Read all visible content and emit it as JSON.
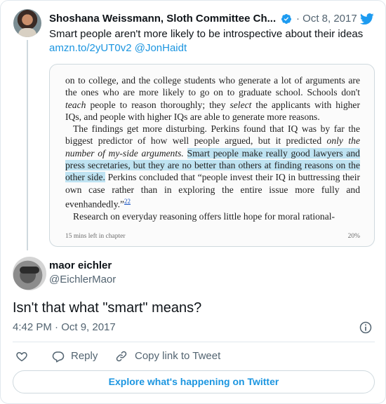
{
  "parent_tweet": {
    "author_name": "Shoshana Weissmann, Sloth Committee Ch...",
    "date": "· Oct 8, 2017",
    "text": "Smart people aren't more likely to be introspective about their ideas",
    "link": "amzn.to/2yUT0v2",
    "mention": "@JonHaidt",
    "book_page": {
      "para1": "on to college, and the college students who generate a lot of arguments are the ones who are more likely to go on to graduate school. Schools don't",
      "para1_em1": "teach",
      "para1_mid": "people to reason thoroughly; they",
      "para1_em2": "select",
      "para1_end": "the applicants with higher IQs, and people with higher IQs are able to generate more reasons.",
      "para2_start": "The findings get more disturbing. Perkins found that IQ was by far the biggest predictor of how well people argued, but it predicted",
      "para2_em": "only the number of my-side arguments.",
      "para2_highlight": "Smart people make really good lawyers and press secretaries, but they are no better than others at finding reasons on the other side.",
      "para2_end": "Perkins concluded that “people invest their IQ in buttressing their own case rather than in exploring the entire issue more fully and evenhandedly.”",
      "footnote_ref": "22",
      "para3": "Research on everyday reasoning offers little hope for moral rational-",
      "footer_left": "15 mins left in chapter",
      "footer_right": "20%"
    }
  },
  "reply_tweet": {
    "author_name": "maor eichler",
    "handle": "@EichlerMaor",
    "text": "Isn't that what \"smart\" means?",
    "timestamp": "4:42 PM · Oct 9, 2017"
  },
  "actions": {
    "reply_label": "Reply",
    "copy_label": "Copy link to Tweet"
  },
  "explore_label": "Explore what's happening on Twitter",
  "colors": {
    "link": "#1b95e0",
    "muted": "#536471",
    "highlight": "#bfe3f2",
    "verified": "#1d9bf0"
  },
  "icons": [
    "verified-icon",
    "twitter-icon",
    "info-icon",
    "heart-icon",
    "reply-icon",
    "link-icon"
  ]
}
